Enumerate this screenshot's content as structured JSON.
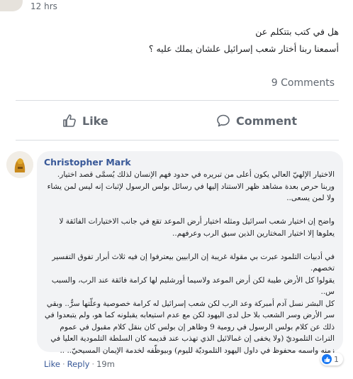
{
  "post": {
    "time": "12 hrs",
    "body_lines": [
      "هل في كتب بتتكلم عن",
      "أسمعنا ربنا أختار شعب إسرائيل علشان يملك عليه ؟"
    ],
    "comments_count": "9 Comments"
  },
  "actions": {
    "like_label": "Like",
    "comment_label": "Comment"
  },
  "comment": {
    "author": "Christopher Mark",
    "lines": [
      "الاختيار الإلهيّ العالي يكون أعلى من تبريره في حدود فهم الإنسان لذلك يُسمَّى قصد اختيار.",
      "وربنا حرص بعدة مشاهد ظهر الاستناد إليها في رسائل بولس الرسول لإثبات إنه ليس لمن يشاء",
      "ولا لمن يسعى..",
      "",
      "واضح إن اختيار شعب اسرائيل ومثله اختيار أرض الموعد تقع في جانب الاختيارات الفائقة لا",
      "يعلوها إلا اختيار المختارين الذين سبق الرب وعرفهم..",
      "",
      "في أدبيات التلمود عبرت بي مقولة غريبة إن الرابيين بيعترفوا إن فيه ثلاث أبرار تفوق التفسير",
      "تخصهم.",
      "يقولوا كل الأرض طيبة لكن أرض الموعد ولاسيما أورشليم لها كرامة فائقة عند الرب، والسبب",
      "س..",
      "كل البشر نسل آدم أمبركة وعد الرب لكن شعب إسرائيل له كرامة خصوصية وعلّتها سرٌّ.. وبقي",
      "سر الأرض وسر الشعب بلا حل لدى اليهود لكن مع عدم استيعابه يقبلونه كما هو، ولم يتبعدوا في",
      "ذلك عن كلام بولس الرسول في رومية 9 وظاهر إن بولس كان بنقل كلام مقبول في عموم",
      "التراث التلموديّ (ولا يخفى إن غمالائيل الذي تهذب عند قديمه كان السلطة التلمودية العليا في",
      "زمنه واسمه محفوظ في داول اليهود التلموديّة لليوم) وبيوظّفه لخدمة الإيمان المسيحيّ.. .."
    ],
    "like_label": "Like",
    "reply_label": "Reply",
    "time": "19m",
    "reaction_count": "1"
  },
  "icons": {
    "like": "thumbs-up-icon",
    "comment": "speech-bubble-icon",
    "reaction": "like-reaction-icon"
  },
  "colors": {
    "link": "#385898",
    "meta": "#606770",
    "bubble": "#f2f3f5",
    "reaction_blue": "#1877f2"
  }
}
